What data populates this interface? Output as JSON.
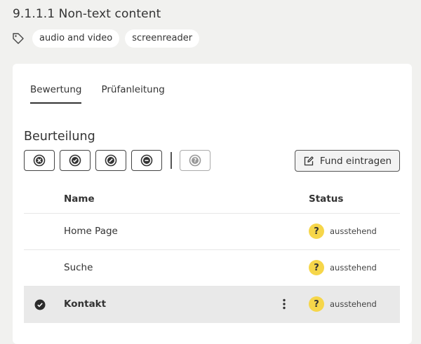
{
  "page": {
    "title": "9.1.1.1 Non-text content",
    "tags": [
      "audio and video",
      "screenreader"
    ]
  },
  "tabs": [
    {
      "label": "Bewertung",
      "active": true
    },
    {
      "label": "Prüfanleitung",
      "active": false
    }
  ],
  "assessment": {
    "title": "Beurteilung",
    "fund_button": "Fund eintragen"
  },
  "table": {
    "headers": {
      "name": "Name",
      "status": "Status"
    },
    "rows": [
      {
        "name": "Home Page",
        "status": "ausstehend",
        "status_symbol": "?",
        "selected": false
      },
      {
        "name": "Suche",
        "status": "ausstehend",
        "status_symbol": "?",
        "selected": false
      },
      {
        "name": "Kontakt",
        "status": "ausstehend",
        "status_symbol": "?",
        "selected": true
      }
    ]
  },
  "colors": {
    "pending": "#f6d64a",
    "background": "#f1f1ef",
    "selected_row": "#e9e9e9"
  }
}
